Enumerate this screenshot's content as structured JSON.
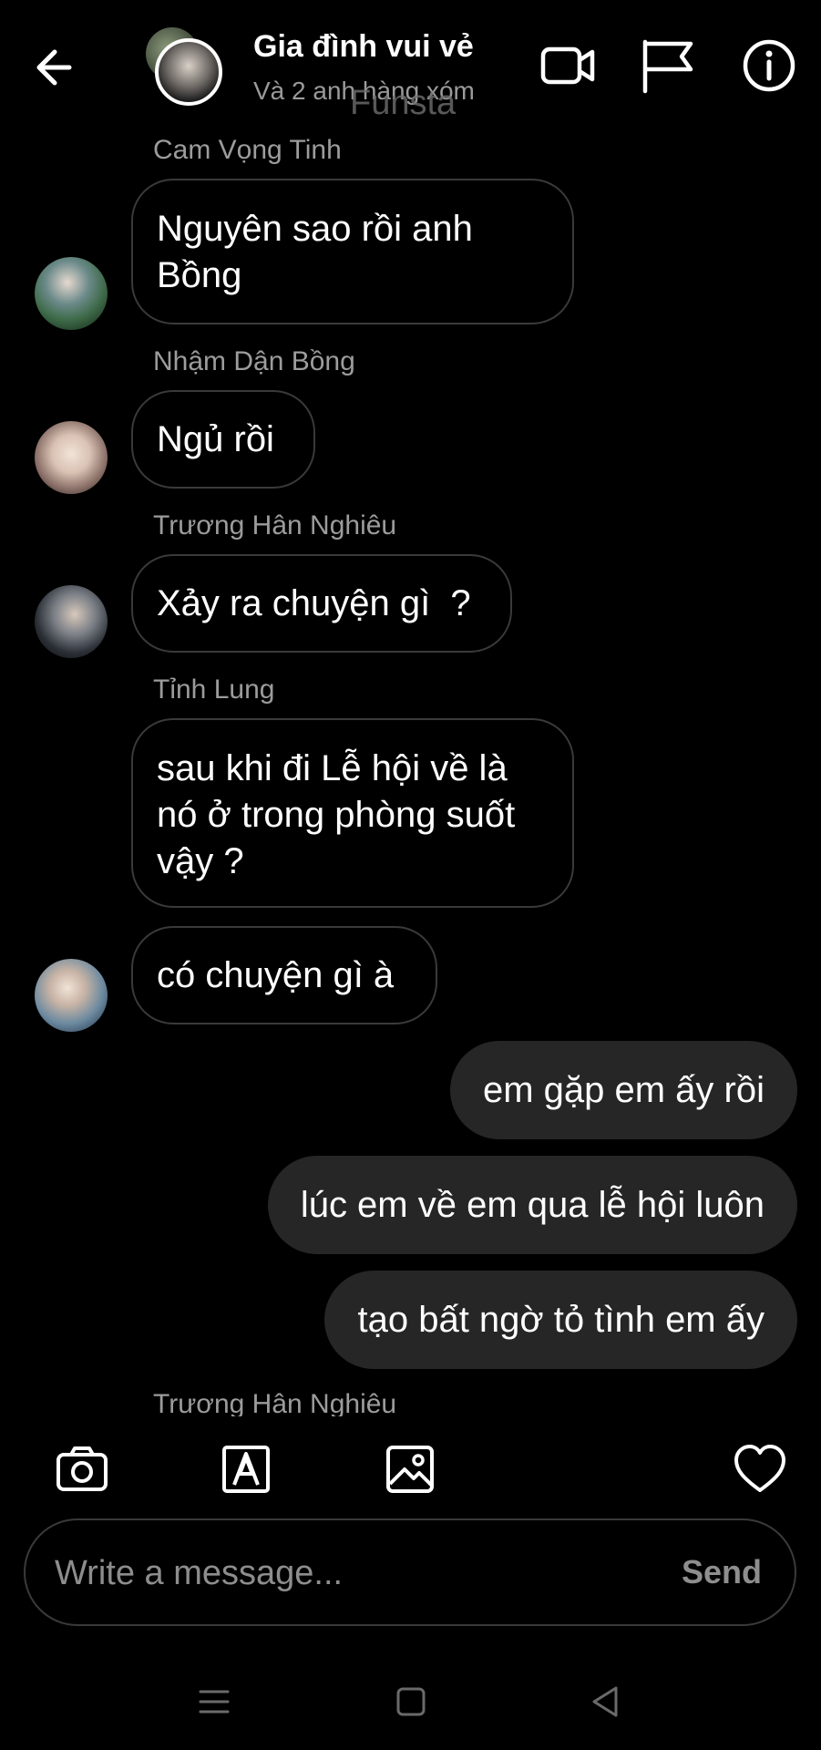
{
  "header": {
    "title": "Gia đình vui vẻ",
    "subtitle": "Và 2 anh hàng xóm",
    "watermark": "Funsta"
  },
  "messages": [
    {
      "sender": "Cam Vọng Tinh",
      "text": "Nguyên sao rồi anh Bồng",
      "direction": "incoming"
    },
    {
      "sender": "Nhậm Dận Bồng",
      "text": "Ngủ rồi",
      "direction": "incoming"
    },
    {
      "sender": "Trương Hân Nghiêu",
      "text": "Xảy ra chuyện gì  ?",
      "direction": "incoming"
    },
    {
      "sender": "Tỉnh Lung",
      "text": "sau khi đi Lễ hội về là nó ở trong phòng suốt vậy ?",
      "direction": "incoming"
    },
    {
      "sender": "",
      "text": "có chuyện gì à",
      "direction": "incoming"
    },
    {
      "sender": "",
      "text": "em gặp em ấy rồi",
      "direction": "outgoing"
    },
    {
      "sender": "",
      "text": "lúc em về em qua lễ hội luôn",
      "direction": "outgoing"
    },
    {
      "sender": "",
      "text": "tạo bất ngờ tỏ tình em ấy",
      "direction": "outgoing"
    }
  ],
  "partial_sender": "Trương Hân Nghiêu",
  "composer": {
    "placeholder": "Write a message...",
    "send_label": "Send"
  },
  "toolbar_icons": [
    "camera-icon",
    "text-style-icon",
    "gallery-icon",
    "heart-icon"
  ],
  "colors": {
    "background": "#000000",
    "outgoing_bubble": "#262626",
    "bubble_border": "#3a3a3a",
    "secondary_text": "#9c9c9c"
  }
}
